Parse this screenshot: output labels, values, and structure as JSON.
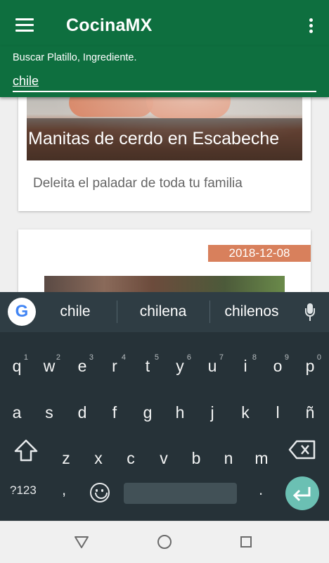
{
  "app": {
    "title": "CocinaMX"
  },
  "search": {
    "label": "Buscar Platillo, Ingrediente.",
    "value": "chile"
  },
  "cards": [
    {
      "title": "Manitas de cerdo en Escabeche",
      "description": "Deleita el paladar de toda tu familia"
    },
    {
      "date": "2018-12-08"
    }
  ],
  "keyboard": {
    "suggestions": [
      "chile",
      "chilena",
      "chilenos"
    ],
    "row1": [
      {
        "k": "q",
        "n": "1"
      },
      {
        "k": "w",
        "n": "2"
      },
      {
        "k": "e",
        "n": "3"
      },
      {
        "k": "r",
        "n": "4"
      },
      {
        "k": "t",
        "n": "5"
      },
      {
        "k": "y",
        "n": "6"
      },
      {
        "k": "u",
        "n": "7"
      },
      {
        "k": "i",
        "n": "8"
      },
      {
        "k": "o",
        "n": "9"
      },
      {
        "k": "p",
        "n": "0"
      }
    ],
    "row2": [
      "a",
      "s",
      "d",
      "f",
      "g",
      "h",
      "j",
      "k",
      "l",
      "ñ"
    ],
    "row3": [
      "z",
      "x",
      "c",
      "v",
      "b",
      "n",
      "m"
    ],
    "symbols_label": "?123",
    "comma": ",",
    "period": "."
  },
  "colors": {
    "primary": "#0e6f3f",
    "accent": "#d8805c",
    "enter": "#6bc0b3",
    "keyboard_bg": "#263238"
  },
  "icons": {
    "menu": "hamburger-icon",
    "overflow": "more-vert-icon",
    "google": "google-g-icon",
    "mic": "mic-icon",
    "shift": "shift-icon",
    "backspace": "backspace-icon",
    "emoji": "emoji-icon",
    "enter": "enter-icon",
    "back": "nav-back-icon",
    "home": "nav-home-icon",
    "recents": "nav-recents-icon"
  }
}
